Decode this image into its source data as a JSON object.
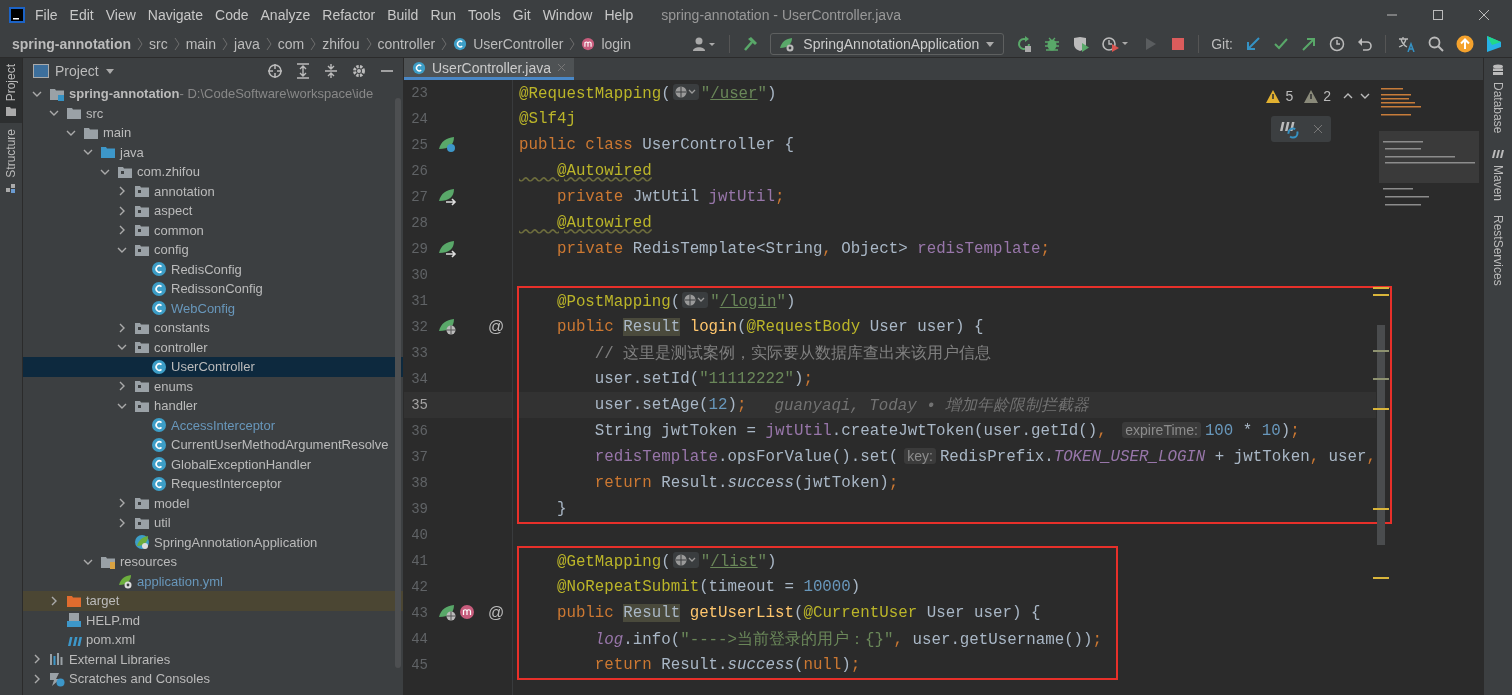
{
  "window": {
    "title": "spring-annotation - UserController.java"
  },
  "menu": [
    "File",
    "Edit",
    "View",
    "Navigate",
    "Code",
    "Analyze",
    "Refactor",
    "Build",
    "Run",
    "Tools",
    "Git",
    "Window",
    "Help"
  ],
  "breadcrumbs": [
    {
      "label": "spring-annotation",
      "kind": "project"
    },
    {
      "label": "src",
      "kind": "dir"
    },
    {
      "label": "main",
      "kind": "dir"
    },
    {
      "label": "java",
      "kind": "dir"
    },
    {
      "label": "com",
      "kind": "dir"
    },
    {
      "label": "zhifou",
      "kind": "dir"
    },
    {
      "label": "controller",
      "kind": "dir"
    },
    {
      "label": "UserController",
      "kind": "class"
    },
    {
      "label": "login",
      "kind": "method"
    }
  ],
  "toolbar": {
    "run_config": "SpringAnnotationApplication",
    "git_label": "Git:"
  },
  "left_strip": [
    {
      "label": "Project",
      "selected": true
    },
    {
      "label": "Structure",
      "selected": false
    }
  ],
  "right_strip": [
    {
      "label": "Database",
      "kind": "database"
    },
    {
      "label": "Maven",
      "kind": "maven"
    },
    {
      "label": "RestServices",
      "kind": "rest"
    }
  ],
  "project_panel": {
    "title": "Project",
    "tree": [
      {
        "label": "spring-annotation",
        "detail": " - D:\\CodeSoftware\\workspace\\ide",
        "kind": "module",
        "expanded": true,
        "selected": false,
        "children": [
          {
            "label": "src",
            "kind": "folder",
            "expanded": true,
            "selected": false,
            "children": [
              {
                "label": "main",
                "kind": "folder",
                "expanded": true,
                "selected": false,
                "children": [
                  {
                    "label": "java",
                    "kind": "source-folder",
                    "expanded": true,
                    "selected": false,
                    "children": [
                      {
                        "label": "com.zhifou",
                        "kind": "package",
                        "expanded": true,
                        "selected": false,
                        "children": [
                          {
                            "label": "annotation",
                            "kind": "package",
                            "expanded": false,
                            "selected": false
                          },
                          {
                            "label": "aspect",
                            "kind": "package",
                            "expanded": false,
                            "selected": false
                          },
                          {
                            "label": "common",
                            "kind": "package",
                            "expanded": false,
                            "selected": false
                          },
                          {
                            "label": "config",
                            "kind": "package",
                            "expanded": true,
                            "selected": false,
                            "children": [
                              {
                                "label": "RedisConfig",
                                "kind": "class",
                                "modified": false,
                                "selected": false
                              },
                              {
                                "label": "RedissonConfig",
                                "kind": "class",
                                "modified": false,
                                "selected": false
                              },
                              {
                                "label": "WebConfig",
                                "kind": "class",
                                "modified": true,
                                "selected": false
                              }
                            ]
                          },
                          {
                            "label": "constants",
                            "kind": "package",
                            "expanded": false,
                            "selected": false
                          },
                          {
                            "label": "controller",
                            "kind": "package",
                            "expanded": true,
                            "selected": false,
                            "children": [
                              {
                                "label": "UserController",
                                "kind": "class",
                                "modified": false,
                                "selected": true
                              }
                            ]
                          },
                          {
                            "label": "enums",
                            "kind": "package",
                            "expanded": false,
                            "selected": false
                          },
                          {
                            "label": "handler",
                            "kind": "package",
                            "expanded": true,
                            "selected": false,
                            "children": [
                              {
                                "label": "AccessInterceptor",
                                "kind": "class",
                                "modified": true,
                                "selected": false
                              },
                              {
                                "label": "CurrentUserMethodArgumentResolve",
                                "kind": "class",
                                "modified": false,
                                "selected": false
                              },
                              {
                                "label": "GlobalExceptionHandler",
                                "kind": "class",
                                "modified": false,
                                "selected": false
                              },
                              {
                                "label": "RequestInterceptor",
                                "kind": "class",
                                "modified": false,
                                "selected": false
                              }
                            ]
                          },
                          {
                            "label": "model",
                            "kind": "package",
                            "expanded": false,
                            "selected": false
                          },
                          {
                            "label": "util",
                            "kind": "package",
                            "expanded": false,
                            "selected": false
                          },
                          {
                            "label": "SpringAnnotationApplication",
                            "kind": "spring-class",
                            "modified": false,
                            "selected": false
                          }
                        ]
                      }
                    ]
                  },
                  {
                    "label": "resources",
                    "kind": "resources-folder",
                    "expanded": true,
                    "selected": false,
                    "children": [
                      {
                        "label": "application.yml",
                        "kind": "yml",
                        "modified": true,
                        "selected": false
                      }
                    ]
                  }
                ]
              }
            ]
          },
          {
            "label": "target",
            "kind": "excluded-folder",
            "expanded": false,
            "selected": false
          },
          {
            "label": "HELP.md",
            "kind": "md",
            "selected": false
          },
          {
            "label": "pom.xml",
            "kind": "maven",
            "selected": false
          }
        ]
      },
      {
        "label": "External Libraries",
        "kind": "libraries",
        "expanded": false,
        "selected": false
      },
      {
        "label": "Scratches and Consoles",
        "kind": "scratches",
        "expanded": false,
        "selected": false
      }
    ]
  },
  "editor": {
    "tabs": [
      {
        "label": "UserController.java",
        "selected": true
      }
    ],
    "warnings": "5",
    "weak_warnings": "2",
    "blocks": [
      {
        "boxed": false,
        "lines": [
          {
            "n": "23",
            "current": false,
            "tokens": [
              {
                "kind": "ann",
                "text": "@RequestMapping"
              },
              {
                "kind": "plain",
                "text": "("
              },
              {
                "kind": "globe"
              },
              {
                "kind": "str",
                "text": "\""
              },
              {
                "kind": "link",
                "text": "/user"
              },
              {
                "kind": "str",
                "text": "\""
              },
              {
                "kind": "plain",
                "text": ")"
              }
            ]
          },
          {
            "n": "24",
            "current": false,
            "tokens": [
              {
                "kind": "ann",
                "text": "@Slf4j"
              }
            ]
          },
          {
            "n": "25",
            "current": false,
            "gutter": [
              {
                "kind": "bean-class"
              }
            ],
            "tokens": [
              {
                "kind": "kw",
                "text": "public class "
              },
              {
                "kind": "plain",
                "text": "UserController {"
              }
            ]
          },
          {
            "n": "26",
            "current": false,
            "tokens": [
              {
                "kind": "ann-warn",
                "text": "    @Autowired"
              }
            ]
          },
          {
            "n": "27",
            "current": false,
            "gutter": [
              {
                "kind": "bean-field"
              }
            ],
            "tokens": [
              {
                "kind": "kw",
                "text": "    private "
              },
              {
                "kind": "plain",
                "text": "JwtUtil "
              },
              {
                "kind": "field",
                "text": "jwtUtil"
              },
              {
                "kind": "kw",
                "text": ";"
              }
            ]
          },
          {
            "n": "28",
            "current": false,
            "tokens": [
              {
                "kind": "ann-warn",
                "text": "    @Autowired"
              }
            ]
          },
          {
            "n": "29",
            "current": false,
            "gutter": [
              {
                "kind": "bean-field"
              }
            ],
            "tokens": [
              {
                "kind": "kw",
                "text": "    private "
              },
              {
                "kind": "plain",
                "text": "RedisTemplate<String"
              },
              {
                "kind": "kw",
                "text": ", "
              },
              {
                "kind": "plain",
                "text": "Object> "
              },
              {
                "kind": "field",
                "text": "redisTemplate"
              },
              {
                "kind": "kw",
                "text": ";"
              }
            ]
          },
          {
            "n": "30",
            "current": false
          }
        ]
      },
      {
        "boxed": true,
        "lines": [
          {
            "n": "31",
            "current": false,
            "tokens": [
              {
                "kind": "ann",
                "text": "    @PostMapping"
              },
              {
                "kind": "plain",
                "text": "("
              },
              {
                "kind": "globe"
              },
              {
                "kind": "str",
                "text": "\""
              },
              {
                "kind": "link",
                "text": "/login"
              },
              {
                "kind": "str",
                "text": "\""
              },
              {
                "kind": "plain",
                "text": ")"
              }
            ]
          },
          {
            "n": "32",
            "current": false,
            "gutter": [
              {
                "kind": "endpoint"
              }
            ],
            "marker": "@",
            "tokens": [
              {
                "kind": "kw",
                "text": "    public "
              },
              {
                "kind": "usage",
                "text": "Result"
              },
              {
                "kind": "method",
                "text": " login"
              },
              {
                "kind": "plain",
                "text": "("
              },
              {
                "kind": "ann",
                "text": "@RequestBody "
              },
              {
                "kind": "plain",
                "text": "User user) {"
              }
            ]
          },
          {
            "n": "33",
            "current": false,
            "tokens": [
              {
                "kind": "comment",
                "text": "        // 这里是测试案例，实际要从数据库查出来该用户信息"
              }
            ]
          },
          {
            "n": "34",
            "current": false,
            "tokens": [
              {
                "kind": "plain",
                "text": "        user.setId("
              },
              {
                "kind": "str",
                "text": "\"11112222\""
              },
              {
                "kind": "plain",
                "text": ")"
              },
              {
                "kind": "kw",
                "text": ";"
              }
            ]
          },
          {
            "n": "35",
            "current": true,
            "blame": "guanyaqi, Today • 增加年龄限制拦截器",
            "tokens": [
              {
                "kind": "plain",
                "text": "        user.setAge("
              },
              {
                "kind": "num",
                "text": "12"
              },
              {
                "kind": "plain",
                "text": ")"
              },
              {
                "kind": "kw",
                "text": ";"
              }
            ]
          },
          {
            "n": "36",
            "current": false,
            "tokens": [
              {
                "kind": "plain",
                "text": "        String jwtToken = "
              },
              {
                "kind": "field",
                "text": "jwtUtil"
              },
              {
                "kind": "plain",
                "text": ".createJwtToken(user.getId()"
              },
              {
                "kind": "kw",
                "text": ", "
              },
              {
                "kind": "hint",
                "text": "expireTime:"
              },
              {
                "kind": "num",
                "text": "100"
              },
              {
                "kind": "plain",
                "text": " * "
              },
              {
                "kind": "num",
                "text": "10"
              },
              {
                "kind": "plain",
                "text": ")"
              },
              {
                "kind": "kw",
                "text": ";"
              }
            ]
          },
          {
            "n": "37",
            "current": false,
            "tokens": [
              {
                "kind": "field",
                "text": "        redisTemplate"
              },
              {
                "kind": "plain",
                "text": ".opsForValue().set("
              },
              {
                "kind": "hint",
                "text": "key:"
              },
              {
                "kind": "plain",
                "text": "RedisPrefix."
              },
              {
                "kind": "static-field",
                "text": "TOKEN_USER_LOGIN"
              },
              {
                "kind": "plain",
                "text": " + jwtToken"
              },
              {
                "kind": "kw",
                "text": ", "
              },
              {
                "kind": "plain",
                "text": "user"
              },
              {
                "kind": "kw",
                "text": ","
              }
            ]
          },
          {
            "n": "38",
            "current": false,
            "tokens": [
              {
                "kind": "kw",
                "text": "        return "
              },
              {
                "kind": "plain",
                "text": "Result."
              },
              {
                "kind": "static",
                "text": "success"
              },
              {
                "kind": "plain",
                "text": "(jwtToken)"
              },
              {
                "kind": "kw",
                "text": ";"
              }
            ]
          },
          {
            "n": "39",
            "current": false,
            "tokens": [
              {
                "kind": "plain",
                "text": "    }"
              }
            ]
          }
        ]
      },
      {
        "boxed": false,
        "lines": [
          {
            "n": "40",
            "current": false
          }
        ]
      },
      {
        "boxed": true,
        "lines": [
          {
            "n": "41",
            "current": false,
            "tokens": [
              {
                "kind": "ann",
                "text": "    @GetMapping"
              },
              {
                "kind": "plain",
                "text": "("
              },
              {
                "kind": "globe"
              },
              {
                "kind": "str",
                "text": "\""
              },
              {
                "kind": "link",
                "text": "/list"
              },
              {
                "kind": "str",
                "text": "\""
              },
              {
                "kind": "plain",
                "text": ")"
              }
            ]
          },
          {
            "n": "42",
            "current": false,
            "tokens": [
              {
                "kind": "ann",
                "text": "    @NoRepeatSubmit"
              },
              {
                "kind": "plain",
                "text": "(timeout = "
              },
              {
                "kind": "num",
                "text": "10000"
              },
              {
                "kind": "plain",
                "text": ")"
              }
            ]
          },
          {
            "n": "43",
            "current": false,
            "gutter": [
              {
                "kind": "endpoint"
              },
              {
                "kind": "mapping"
              }
            ],
            "marker": "@",
            "tokens": [
              {
                "kind": "kw",
                "text": "    public "
              },
              {
                "kind": "usage",
                "text": "Result"
              },
              {
                "kind": "method",
                "text": " getUserList"
              },
              {
                "kind": "plain",
                "text": "("
              },
              {
                "kind": "ann",
                "text": "@CurrentUser "
              },
              {
                "kind": "plain",
                "text": "User user) {"
              }
            ]
          },
          {
            "n": "44",
            "current": false,
            "tokens": [
              {
                "kind": "static-field",
                "text": "        log"
              },
              {
                "kind": "plain",
                "text": ".info("
              },
              {
                "kind": "str",
                "text": "\"---->当前登录的用户：{}\""
              },
              {
                "kind": "kw",
                "text": ", "
              },
              {
                "kind": "plain",
                "text": "user.getUsername())"
              },
              {
                "kind": "kw",
                "text": ";"
              }
            ]
          },
          {
            "n": "45",
            "current": false,
            "tokens": [
              {
                "kind": "kw",
                "text": "        return "
              },
              {
                "kind": "plain",
                "text": "Result."
              },
              {
                "kind": "static",
                "text": "success"
              },
              {
                "kind": "plain",
                "text": "("
              },
              {
                "kind": "kw",
                "text": "null"
              },
              {
                "kind": "plain",
                "text": ")"
              },
              {
                "kind": "kw",
                "text": ";"
              }
            ]
          }
        ]
      }
    ]
  }
}
